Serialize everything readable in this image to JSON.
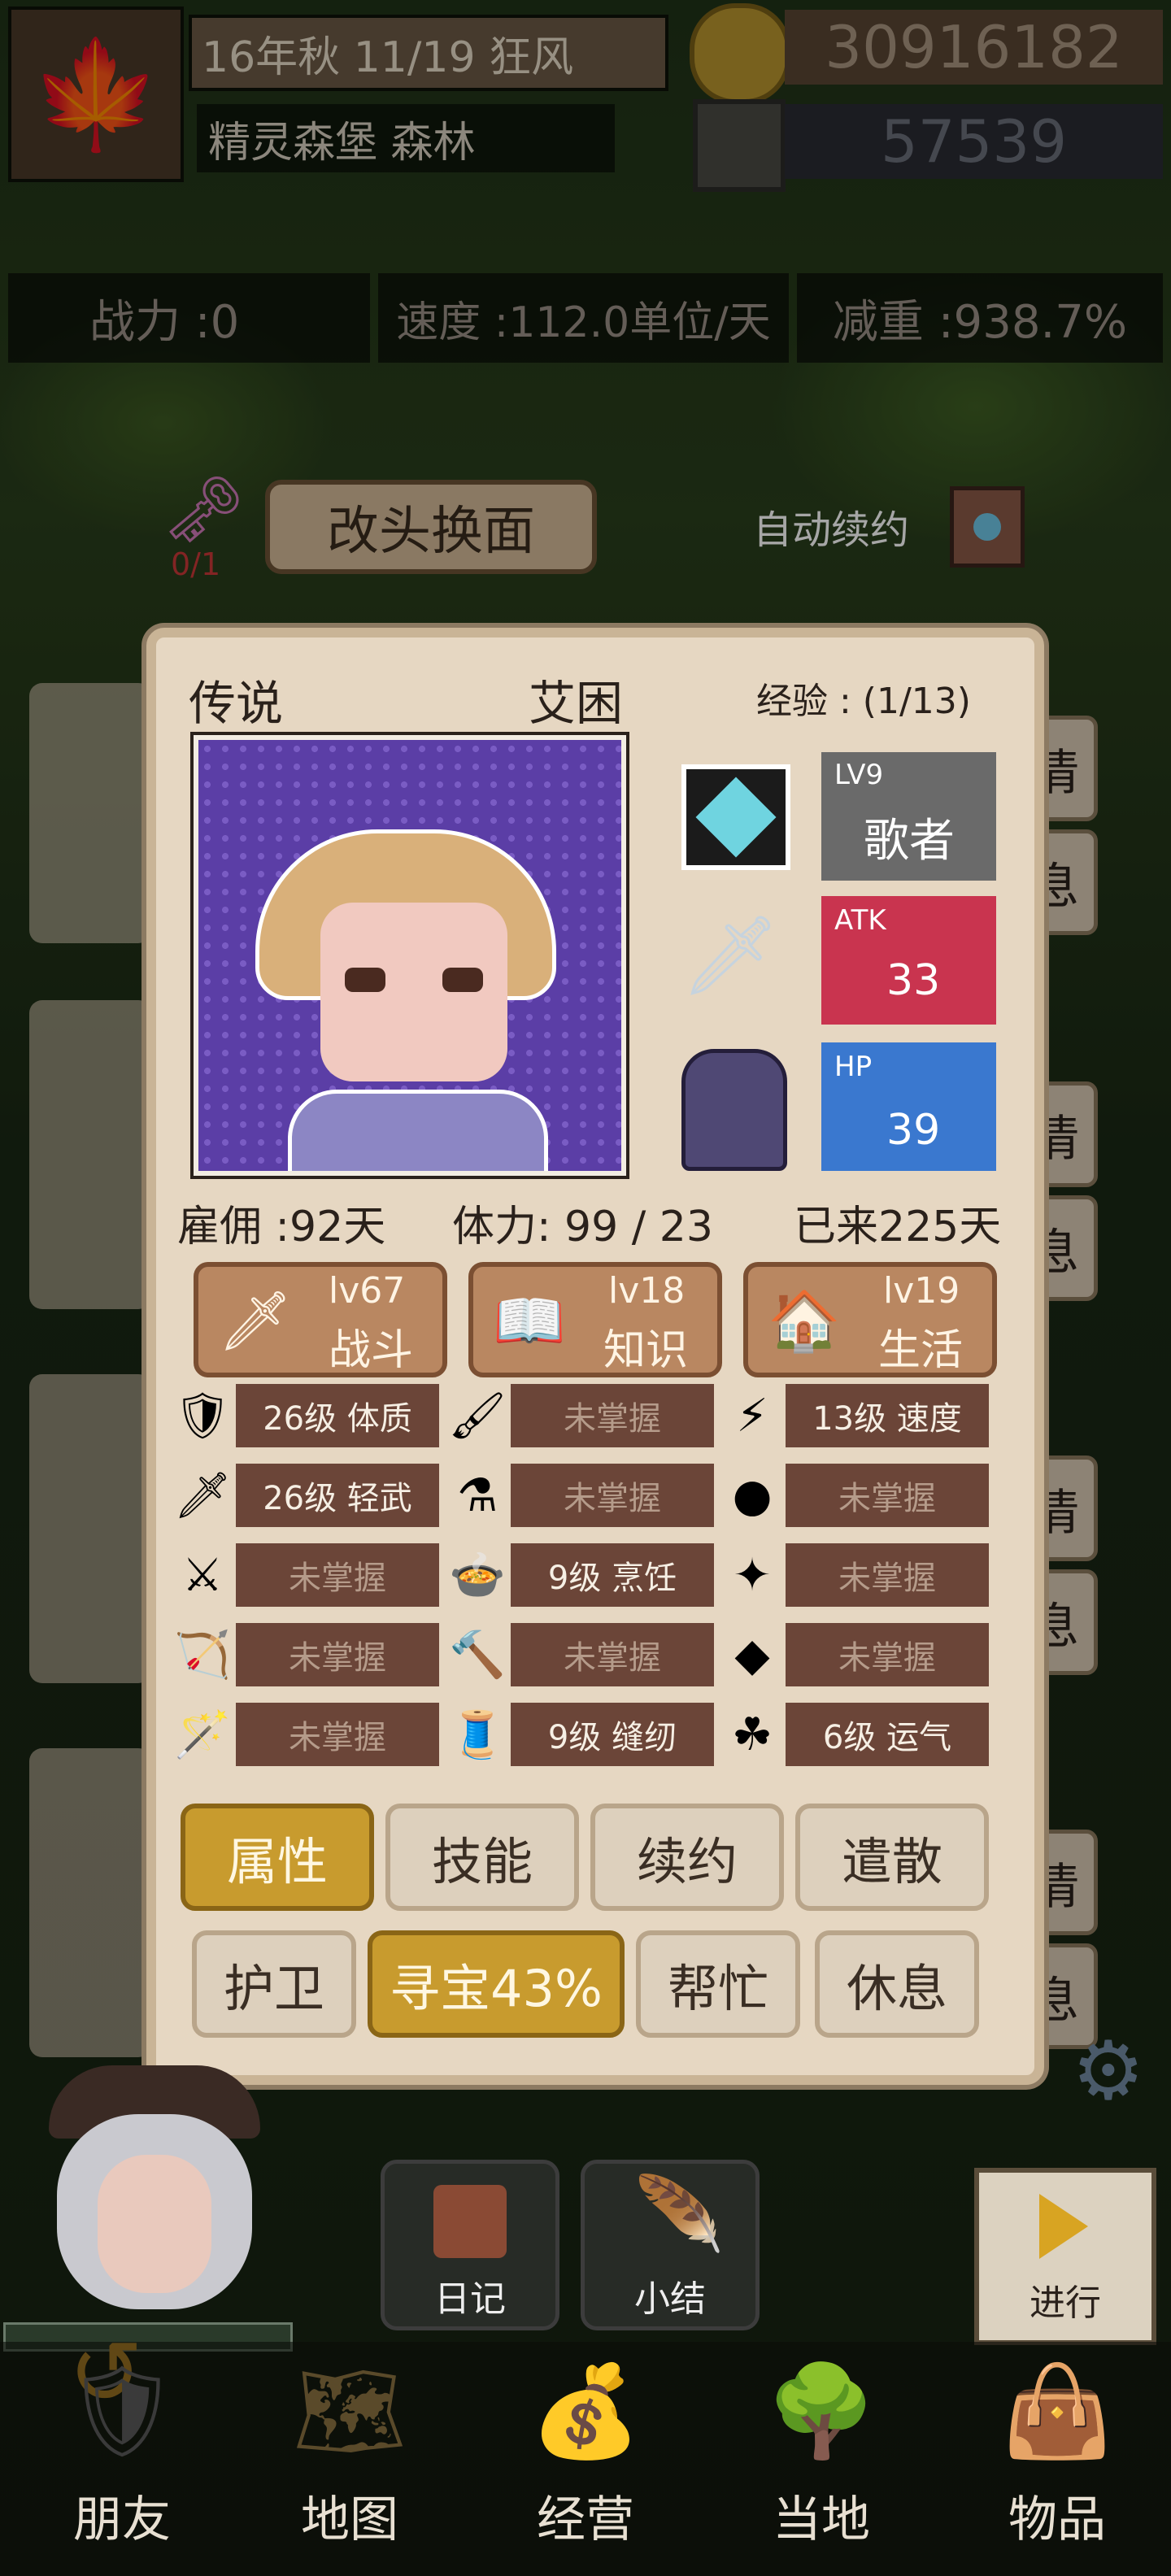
{
  "top": {
    "date": "16年秋 11/19 狂风",
    "location": "精灵森堡 森林",
    "gold": "30916182",
    "gems": "57539"
  },
  "stats_bar": {
    "power": "战力 :0",
    "speed": "速度 :112.0单位/天",
    "weight": "减重 :938.7%"
  },
  "actions": {
    "item_count": "0/1",
    "makeover_label": "改头换面",
    "auto_renew_label": "自动续约"
  },
  "popup": {
    "rarity": "传说",
    "name": "艾困",
    "exp": "经验 : (1/13)",
    "class_level": "LV9",
    "class_name": "歌者",
    "atk_label": "ATK",
    "atk_value": "33",
    "hp_label": "HP",
    "hp_value": "39",
    "employ": "雇佣 :92天",
    "stamina": "体力: 99 / 23",
    "arrived": "已来225天",
    "categories": [
      {
        "level": "lv67",
        "name": "战斗",
        "icon": "sword-icon"
      },
      {
        "level": "lv18",
        "name": "知识",
        "icon": "book-icon"
      },
      {
        "level": "lv19",
        "name": "生活",
        "icon": "house-icon"
      }
    ],
    "skills": [
      [
        "26级 体质",
        "未掌握",
        "13级 速度"
      ],
      [
        "26级 轻武",
        "未掌握",
        "未掌握"
      ],
      [
        "未掌握",
        "9级 烹饪",
        "未掌握"
      ],
      [
        "未掌握",
        "未掌握",
        "未掌握"
      ],
      [
        "未掌握",
        "9级 缝纫",
        "6级 运气"
      ]
    ],
    "tabs": [
      "属性",
      "技能",
      "续约",
      "遣散"
    ],
    "tasks": [
      "护卫",
      "寻宝43%",
      "帮忙",
      "休息"
    ]
  },
  "side_buttons": [
    "情",
    "息",
    "情",
    "息",
    "情",
    "息",
    "情",
    "息"
  ],
  "bottom_actions": {
    "diary": "日记",
    "summary": "小结",
    "proceed": "进行"
  },
  "nav": [
    "朋友",
    "地图",
    "经营",
    "当地",
    "物品"
  ],
  "colors": {
    "atk_bg": "#c9344f",
    "hp_bg": "#3a78cf",
    "level_bg": "#6a6a6a",
    "active_tab": "#c89b2e"
  }
}
